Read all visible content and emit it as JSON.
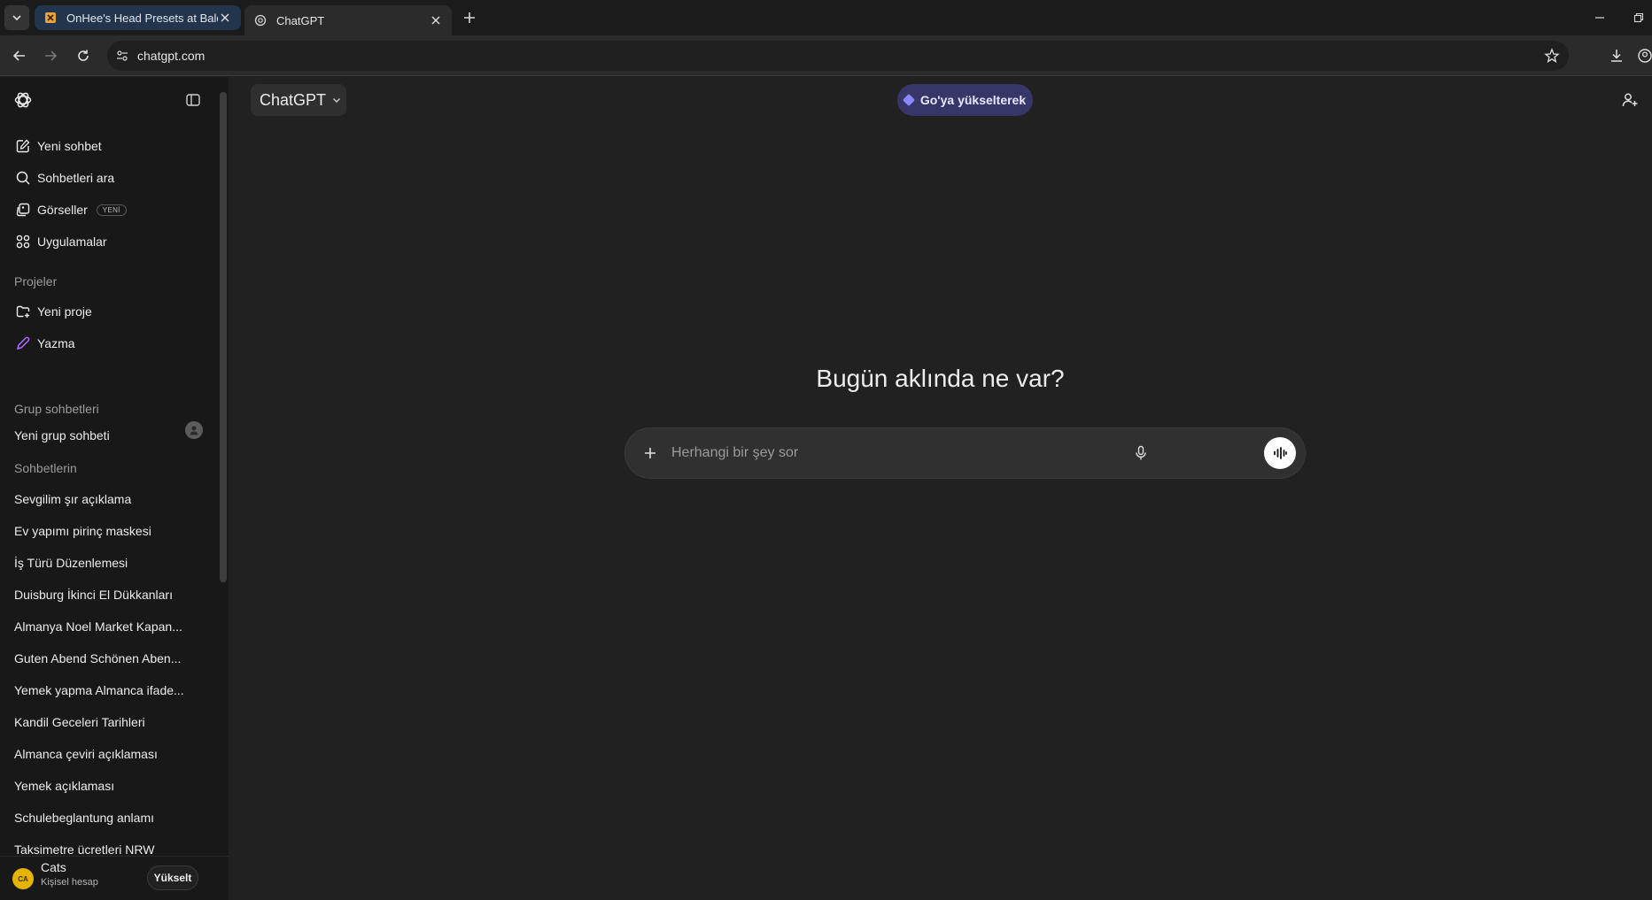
{
  "browser": {
    "tabs": [
      {
        "title": "OnHee's Head Presets at Baldur",
        "active": false,
        "favicon": "nexus-mods-icon"
      },
      {
        "title": "ChatGPT",
        "active": true,
        "favicon": "openai-icon"
      }
    ],
    "url": "chatgpt.com"
  },
  "sidebar": {
    "nav": [
      {
        "label": "Yeni sohbet",
        "icon": "new-chat-icon"
      },
      {
        "label": "Sohbetleri ara",
        "icon": "search-icon"
      },
      {
        "label": "Görseller",
        "icon": "images-icon",
        "badge": "YENİ"
      },
      {
        "label": "Uygulamalar",
        "icon": "apps-icon"
      }
    ],
    "projects_label": "Projeler",
    "projects": [
      {
        "label": "Yeni proje",
        "icon": "new-project-icon"
      },
      {
        "label": "Yazma",
        "icon": "writing-icon",
        "icon_color": "#b06cff"
      }
    ],
    "group_label": "Grup sohbetleri",
    "group_new": "Yeni grup sohbeti",
    "chats_label": "Sohbetlerin",
    "chats": [
      "Sevgilim şır açıklama",
      "Ev yapımı pirinç maskesi",
      "İş Türü Düzenlemesi",
      "Duisburg İkinci El Dükkanları",
      "Almanya Noel Market Kapan...",
      "Guten Abend Schönen Aben...",
      "Yemek yapma Almanca ifade...",
      "Kandil Geceleri Tarihleri",
      "Almanca çeviri açıklaması",
      "Yemek açıklaması",
      "Schulebeglantung anlamı",
      "Taksimetre ücretleri NRW"
    ],
    "user": {
      "initials": "CA",
      "name": "Cats",
      "plan": "Kişisel hesap",
      "upgrade": "Yükselt"
    }
  },
  "main": {
    "model": "ChatGPT",
    "upgrade_pill": "Go'ya yükselterek",
    "headline": "Bugün aklında ne var?",
    "composer_placeholder": "Herhangi bir şey sor"
  },
  "colors": {
    "background": "#212121",
    "sidebar": "#181818",
    "go_pill": "#373669",
    "go_diamond": "#8c86ff"
  }
}
